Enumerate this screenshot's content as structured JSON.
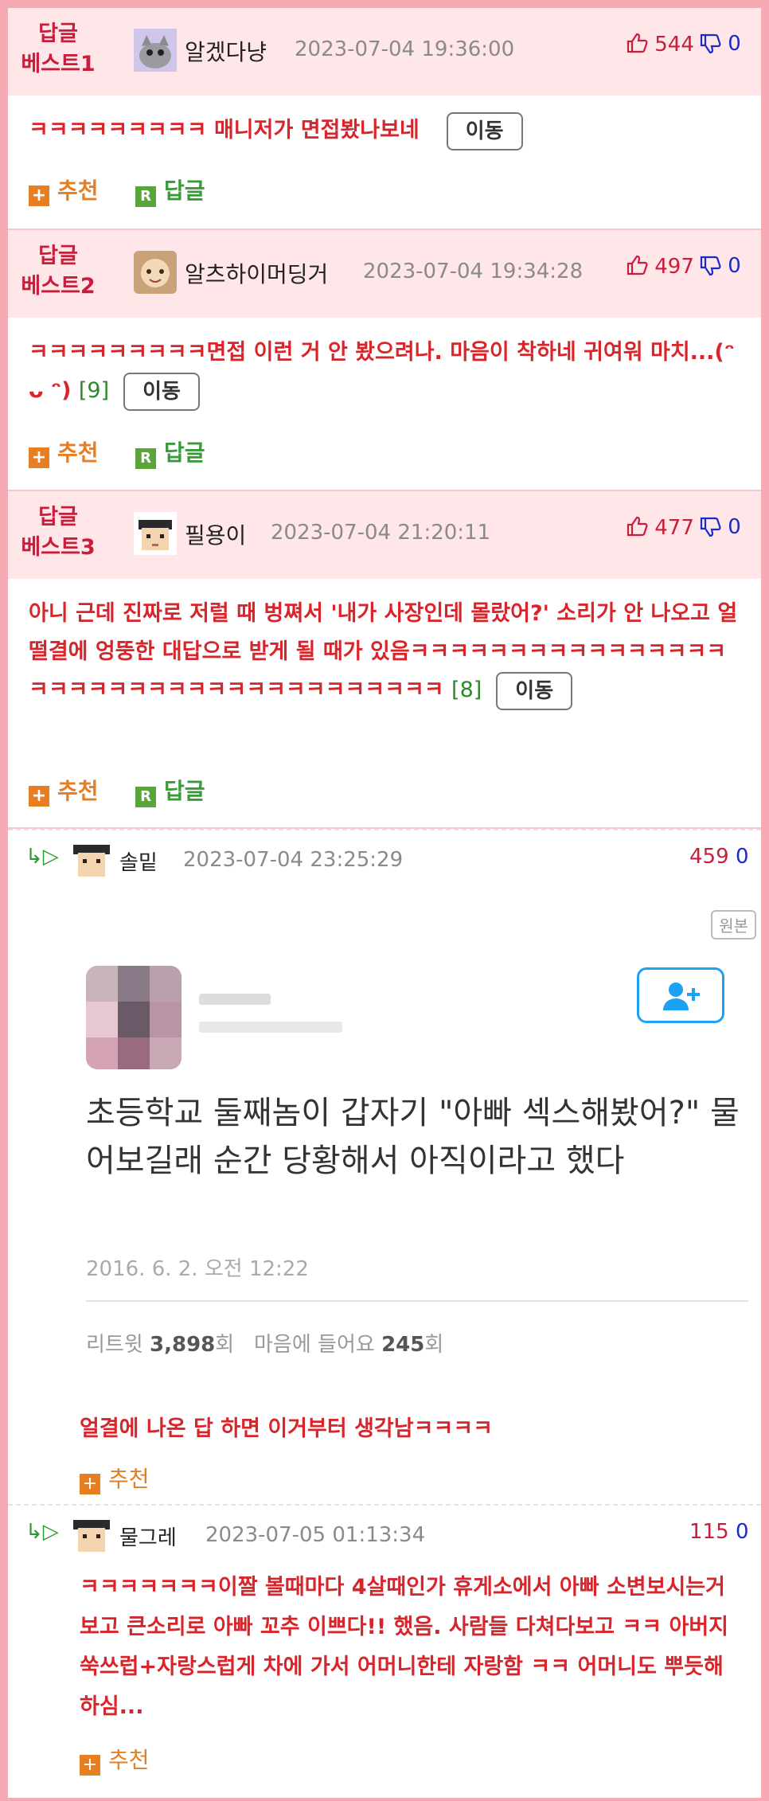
{
  "best": [
    {
      "label1": "답글",
      "label2": "베스트1",
      "nick": "알겠다냥",
      "date": "2023-07-04 19:36:00",
      "likes": "544",
      "dislikes": "0",
      "text": "ㅋㅋㅋㅋㅋㅋㅋㅋㅋ 매니저가 면접봤나보네",
      "count": "",
      "move": "이동",
      "rec": "추천",
      "reply": "답글"
    },
    {
      "label1": "답글",
      "label2": "베스트2",
      "nick": "알츠하이머딩거",
      "date": "2023-07-04 19:34:28",
      "likes": "497",
      "dislikes": "0",
      "text": "ㅋㅋㅋㅋㅋㅋㅋㅋㅋ면접 이런 거 안 봤으려나. 마음이 착하네 귀여워 마치...(ᵔ ᴗ ᵔ)",
      "count": "[9]",
      "move": "이동",
      "rec": "추천",
      "reply": "답글"
    },
    {
      "label1": "답글",
      "label2": "베스트3",
      "nick": "필용이",
      "date": "2023-07-04 21:20:11",
      "likes": "477",
      "dislikes": "0",
      "text": "아니 근데 진짜로 저럴 때 벙쪄서 '내가 사장인데 몰랐어?' 소리가 안 나오고 얼떨결에 엉뚱한 대답으로 받게 될 때가 있음ㅋㅋㅋㅋㅋㅋㅋㅋㅋㅋㅋㅋㅋㅋㅋㅋㅋㅋㅋㅋㅋㅋㅋㅋㅋㅋㅋㅋㅋㅋㅋㅋㅋㅋㅋㅋㅋ",
      "count": "[8]",
      "move": "이동",
      "rec": "추천",
      "reply": "답글"
    }
  ],
  "replies": [
    {
      "nick": "솔밑",
      "date": "2023-07-04 23:25:29",
      "likes": "459",
      "dislikes": "0",
      "original": "원본",
      "tweet_text": "초등학교 둘째놈이 갑자기  \"아빠  섹스해봤어?\" 물어보길래 순간 당황해서  아직이라고 했다",
      "tweet_date": "2016. 6. 2. 오전 12:22",
      "retweet_label": "리트윗",
      "retweet_count": "3,898",
      "retweet_unit": "회",
      "like_label": "마음에 들어요",
      "like_count": "245",
      "like_unit": "회",
      "text": "얼결에 나온 답 하면 이거부터 생각남ㅋㅋㅋㅋ",
      "rec": "추천"
    },
    {
      "nick": "물그레",
      "date": "2023-07-05 01:13:34",
      "likes": "115",
      "dislikes": "0",
      "text": "ㅋㅋㅋㅋㅋㅋㅋ이짤 볼때마다 4살때인가 휴게소에서 아빠 소변보시는거 보고 큰소리로 아빠 꼬추 이쁘다!! 했음. 사람들 다쳐다보고 ㅋㅋ 아버지 쑥쓰럽+자랑스럽게 차에 가서 어머니한테 자랑함 ㅋㅋ 어머니도 뿌듯해 하심...",
      "rec": "추천"
    }
  ],
  "icons": {
    "thumb_up": "thumbs-up-outline",
    "thumb_down": "thumbs-down-outline",
    "reply_arrow": "reply-arrow",
    "follow": "add-user"
  },
  "colors": {
    "border": "#f7aab4",
    "best_bg": "#ffe6e9",
    "accent": "#c81e3c",
    "text_red": "#d8252b",
    "orange": "#e67e22",
    "green": "#5aa53a"
  }
}
